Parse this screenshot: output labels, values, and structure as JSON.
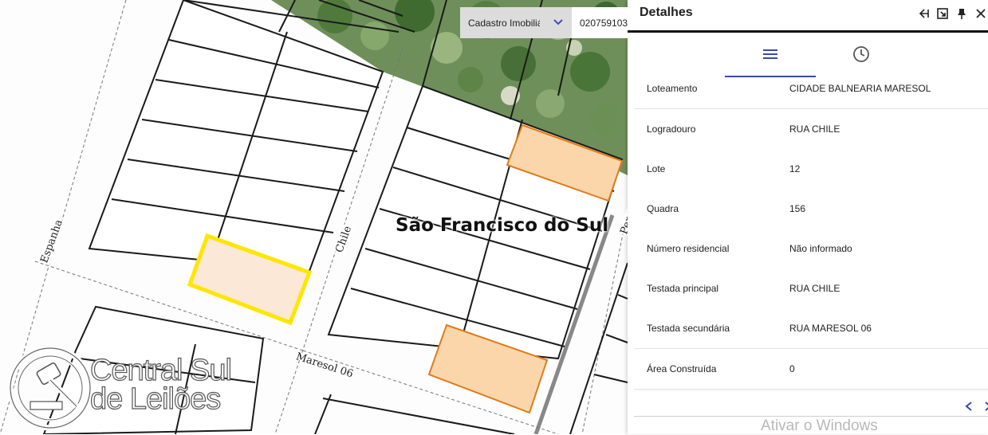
{
  "map": {
    "layer_select": {
      "value": "Cadastro Imobiliário"
    },
    "search": {
      "value": "020759103"
    },
    "city_label": "São Francisco do Sul",
    "streets": {
      "espanha": "Espanha",
      "chile": "Chile",
      "maresol": "Maresol 06",
      "peru": "Peru"
    },
    "logo": {
      "line1": "Central Sul",
      "line2": "de Leilões"
    },
    "colors": {
      "selected": "#ffe600",
      "highlight": "#e07b1a",
      "lot_fill": "#fbd6aa"
    }
  },
  "panel": {
    "title": "Detalhes",
    "header_icons": [
      "collapse-left-icon",
      "popout-icon",
      "pin-icon",
      "close-icon"
    ],
    "tabs": [
      {
        "icon": "list-icon",
        "active": true
      },
      {
        "icon": "history-icon",
        "active": false
      }
    ],
    "rows": [
      {
        "label": "Loteamento",
        "value": "CIDADE BALNEARIA MARESOL"
      },
      {
        "label": "Logradouro",
        "value": "RUA CHILE"
      },
      {
        "label": "Lote",
        "value": "12"
      },
      {
        "label": "Quadra",
        "value": "156"
      },
      {
        "label": "Número residencial",
        "value": "Não informado"
      },
      {
        "label": "Testada principal",
        "value": "RUA CHILE"
      },
      {
        "label": "Testada secundária",
        "value": "RUA MARESOL 06"
      },
      {
        "label": "Área Construída",
        "value": "0"
      }
    ],
    "watermark": "Ativar o Windows"
  }
}
